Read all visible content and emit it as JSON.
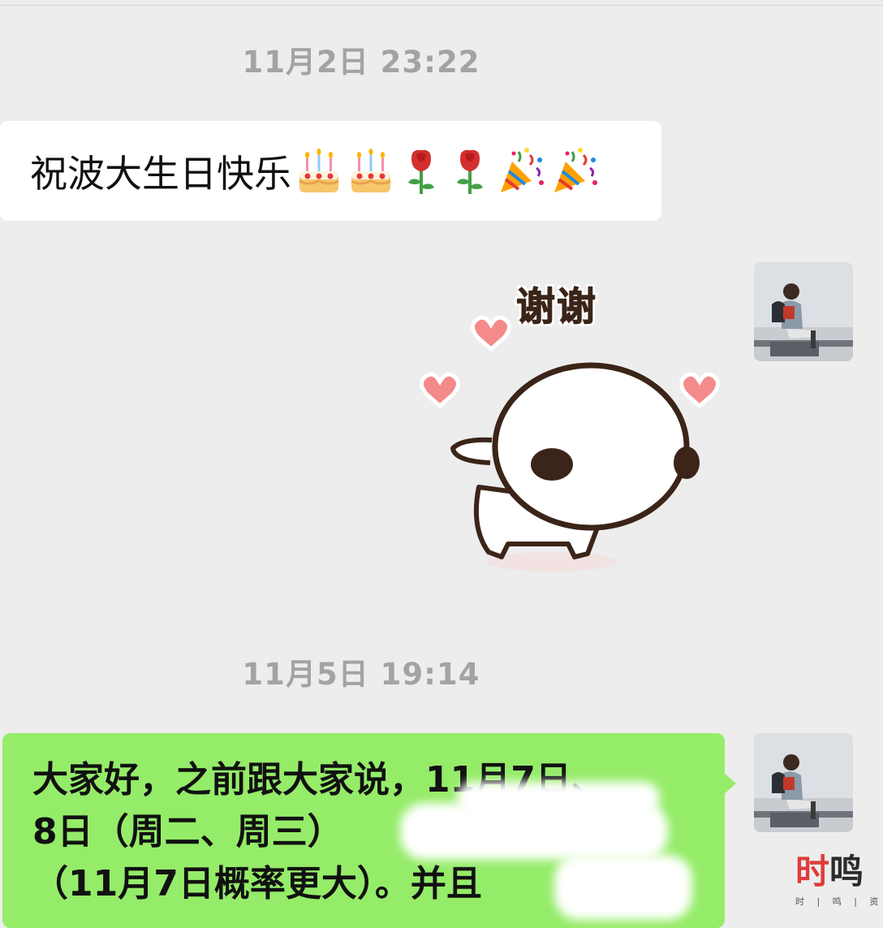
{
  "chat": {
    "timestamp_1": "11月2日 23:22",
    "timestamp_2": "11月5日 19:14",
    "incoming_message": {
      "text": "祝波大生日快乐",
      "emojis": [
        "birthday-cake-icon",
        "birthday-cake-icon",
        "rose-icon",
        "rose-icon",
        "party-popper-icon",
        "party-popper-icon"
      ]
    },
    "sticker": {
      "label": "谢谢"
    },
    "outgoing_message": {
      "line1": "大家好，之前跟大家说，11月7日、",
      "line2": "8日（周二、周三）",
      "line3": "（11月7日概率更大）。并且"
    }
  },
  "watermark": {
    "main_first": "时",
    "main_rest": "鸣",
    "sub": "时 | 鸣 | 资 | 产"
  },
  "colors": {
    "background": "#ededed",
    "incoming_bubble": "#ffffff",
    "outgoing_bubble": "#95ec69",
    "timestamp_text": "#a3a3a3"
  }
}
